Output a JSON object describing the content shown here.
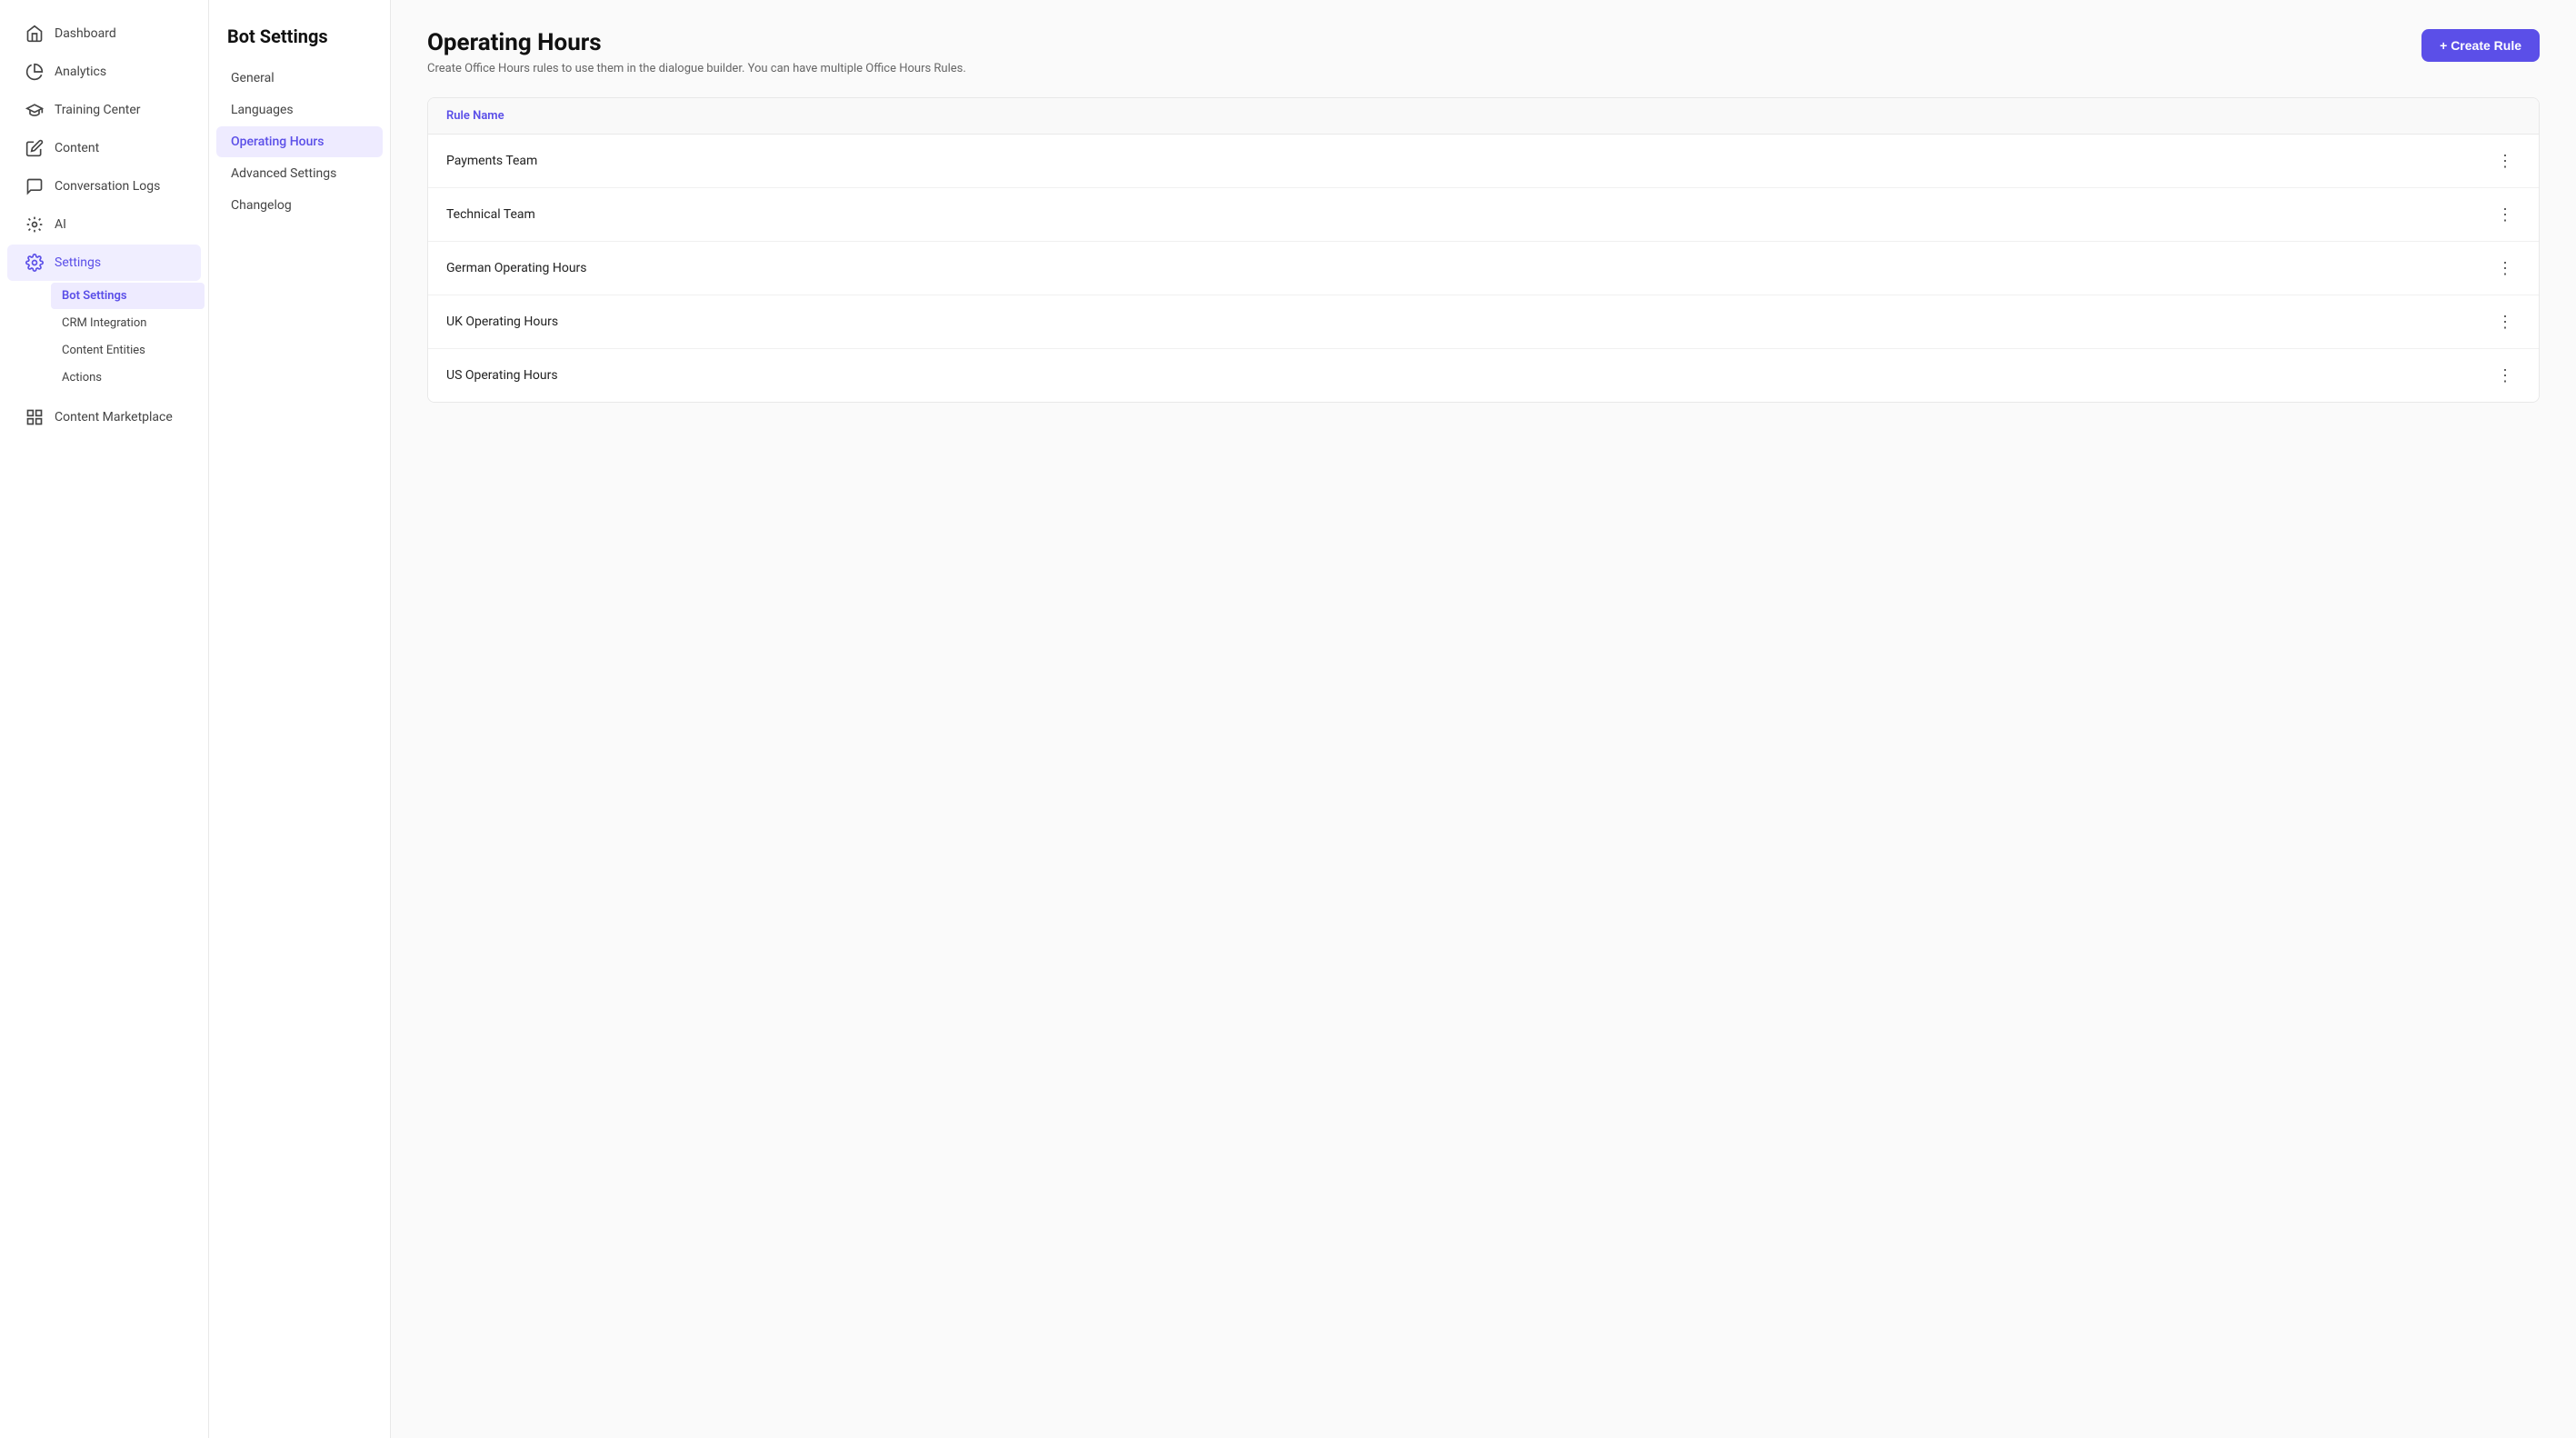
{
  "sidebar": {
    "items": [
      {
        "id": "dashboard",
        "label": "Dashboard",
        "icon": "home"
      },
      {
        "id": "analytics",
        "label": "Analytics",
        "icon": "analytics"
      },
      {
        "id": "training-center",
        "label": "Training Center",
        "icon": "graduation"
      },
      {
        "id": "content",
        "label": "Content",
        "icon": "edit"
      },
      {
        "id": "conversation-logs",
        "label": "Conversation Logs",
        "icon": "chat"
      },
      {
        "id": "ai",
        "label": "AI",
        "icon": "ai"
      },
      {
        "id": "settings",
        "label": "Settings",
        "icon": "gear",
        "active": true
      },
      {
        "id": "content-marketplace",
        "label": "Content Marketplace",
        "icon": "grid"
      }
    ],
    "sub_items": [
      {
        "id": "bot-settings",
        "label": "Bot Settings",
        "active": true
      },
      {
        "id": "crm-integration",
        "label": "CRM Integration"
      },
      {
        "id": "content-entities",
        "label": "Content Entities"
      },
      {
        "id": "actions",
        "label": "Actions"
      }
    ]
  },
  "mid_nav": {
    "title": "Bot Settings",
    "items": [
      {
        "id": "general",
        "label": "General"
      },
      {
        "id": "languages",
        "label": "Languages"
      },
      {
        "id": "operating-hours",
        "label": "Operating Hours",
        "active": true
      },
      {
        "id": "advanced-settings",
        "label": "Advanced Settings"
      },
      {
        "id": "changelog",
        "label": "Changelog"
      }
    ]
  },
  "main": {
    "title": "Operating Hours",
    "description": "Create Office Hours rules to use them in the dialogue builder. You can have multiple Office Hours Rules.",
    "create_button_label": "+ Create Rule",
    "table_header": "Rule Name",
    "rules": [
      {
        "id": "payments-team",
        "name": "Payments Team"
      },
      {
        "id": "technical-team",
        "name": "Technical Team"
      },
      {
        "id": "german-operating-hours",
        "name": "German Operating Hours"
      },
      {
        "id": "uk-operating-hours",
        "name": "UK Operating Hours"
      },
      {
        "id": "us-operating-hours",
        "name": "US Operating Hours"
      }
    ]
  }
}
